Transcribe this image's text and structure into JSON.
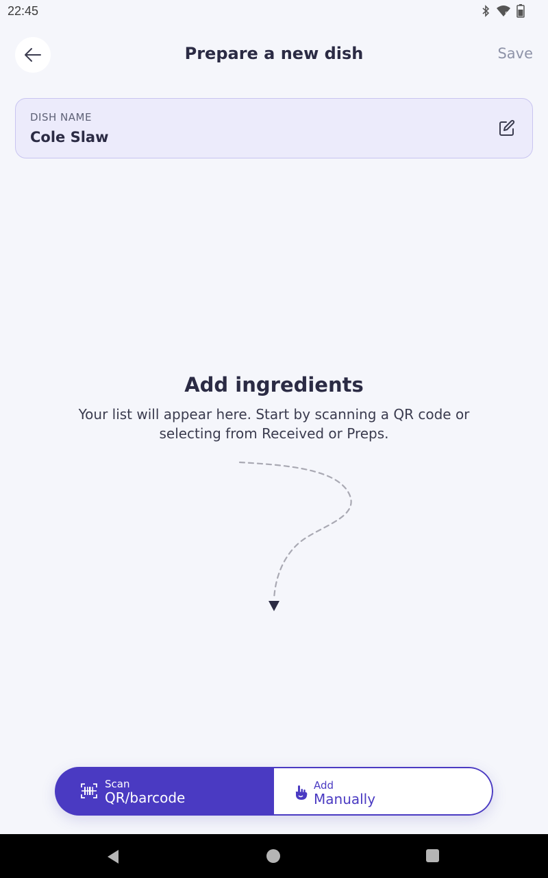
{
  "status_bar": {
    "time": "22:45",
    "icons": [
      "bluetooth-icon",
      "wifi-icon",
      "battery-icon"
    ]
  },
  "header": {
    "title": "Prepare a new dish",
    "save_label": "Save",
    "back_icon": "arrow-left-icon"
  },
  "dish": {
    "label": "DISH NAME",
    "value": "Cole Slaw",
    "edit_icon": "edit-icon"
  },
  "empty_state": {
    "title": "Add ingredients",
    "text": "Your list will appear here. Start by scanning a QR code or selecting from Received or Preps."
  },
  "actions": {
    "scan": {
      "small": "Scan",
      "big": "QR/barcode",
      "icon": "barcode-icon"
    },
    "manual": {
      "small": "Add",
      "big": "Manually",
      "icon": "hand-pointer-icon"
    }
  },
  "colors": {
    "accent": "#4a3ac2",
    "card_bg": "#ecebfb",
    "page_bg": "#f5f6fb"
  }
}
